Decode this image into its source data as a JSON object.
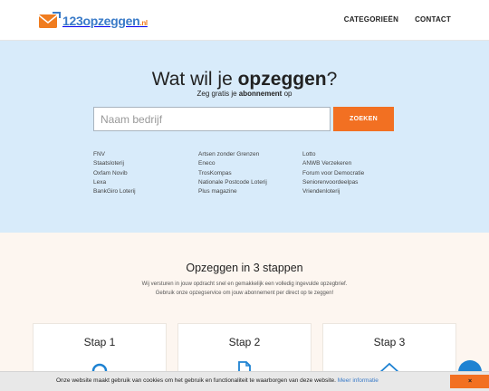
{
  "header": {
    "logo": {
      "number": "123",
      "word": "opzeggen",
      "tld": ".nl"
    },
    "nav": [
      {
        "label": "CATEGORIEËN"
      },
      {
        "label": "CONTACT"
      }
    ]
  },
  "hero": {
    "title_prefix": "Wat wil je ",
    "title_bold": "opzeggen",
    "title_suffix": "?",
    "subtitle_prefix": "Zeg gratis je ",
    "subtitle_bold": "abonnement",
    "subtitle_suffix": " op",
    "search": {
      "placeholder": "Naam bedrijf",
      "value": ""
    },
    "search_button": "ZOEKEN",
    "link_columns": [
      [
        "FNV",
        "Staatsloterij",
        "Oxfam Novib",
        "Lexa",
        "BankGiro Loterij"
      ],
      [
        "Artsen zonder Grenzen",
        "Eneco",
        "TrosKompas",
        "Nationale Postcode Loterij",
        "Plus magazine"
      ],
      [
        "Lotto",
        "ANWB Verzekeren",
        "Forum voor Democratie",
        "Seniorenvoordeelpas",
        "Vriendenloterij"
      ]
    ]
  },
  "steps": {
    "title": "Opzeggen in 3 stappen",
    "desc_line1": "Wij versturen in jouw opdracht snel en gemakkelijk een volledig ingevulde opzegbrief.",
    "desc_line2": "Gebruik onze opzegservice om jouw abonnement per direct op te zeggen!",
    "cards": [
      {
        "title": "Stap 1",
        "icon": "search-icon"
      },
      {
        "title": "Stap 2",
        "icon": "document-icon"
      },
      {
        "title": "Stap 3",
        "icon": "envelope-icon"
      }
    ]
  },
  "cookie": {
    "text": "Onze website maakt gebruik van cookies om het gebruik en functionaliteit te waarborgen van deze website.",
    "link": "Meer informatie",
    "close": "×"
  },
  "colors": {
    "accent": "#f27022",
    "brand_blue": "#3a7bc8",
    "hero_bg": "#d8ebfa",
    "steps_bg": "#fdf6f0",
    "fab": "#1e82d2"
  }
}
